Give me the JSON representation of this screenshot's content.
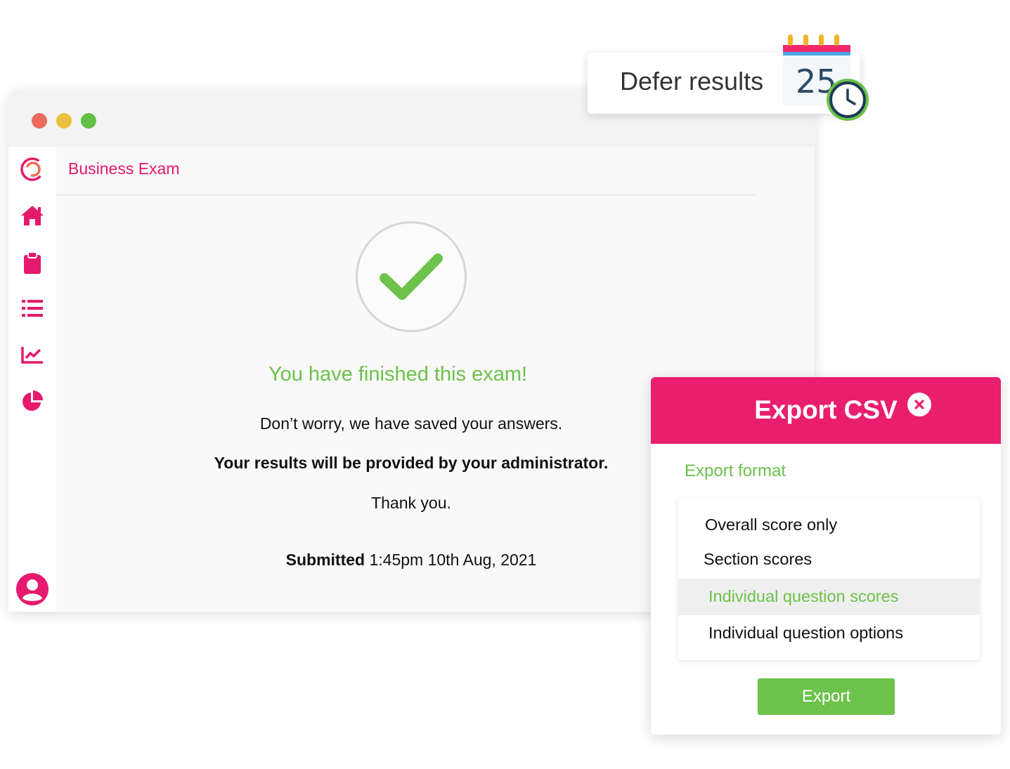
{
  "window": {
    "exam_title": "Business Exam"
  },
  "sidebar": {
    "items": [
      {
        "icon": "brand-logo-icon"
      },
      {
        "icon": "home-icon"
      },
      {
        "icon": "clipboard-icon"
      },
      {
        "icon": "list-icon"
      },
      {
        "icon": "line-chart-icon"
      },
      {
        "icon": "pie-chart-icon"
      },
      {
        "icon": "user-avatar-icon"
      }
    ]
  },
  "main": {
    "finished_title": "You have finished this exam!",
    "saved_message": "Don’t worry, we have saved your answers.",
    "results_message": "Your results will be provided by your administrator.",
    "thanks": "Thank you.",
    "submitted_label": "Submitted",
    "submitted_value": "1:45pm 10th Aug, 2021"
  },
  "defer": {
    "label": "Defer results",
    "calendar_day": "25"
  },
  "export_modal": {
    "title": "Export CSV",
    "section_label": "Export format",
    "options": [
      {
        "label": "Overall score only"
      },
      {
        "label": "Section scores"
      },
      {
        "label": "Individual question scores",
        "selected": true
      },
      {
        "label": "Individual question options"
      }
    ],
    "export_label": "Export"
  },
  "colors": {
    "brand_pink": "#e5196d",
    "accent_green": "#6cc24a",
    "modal_header": "#e91e6e"
  }
}
